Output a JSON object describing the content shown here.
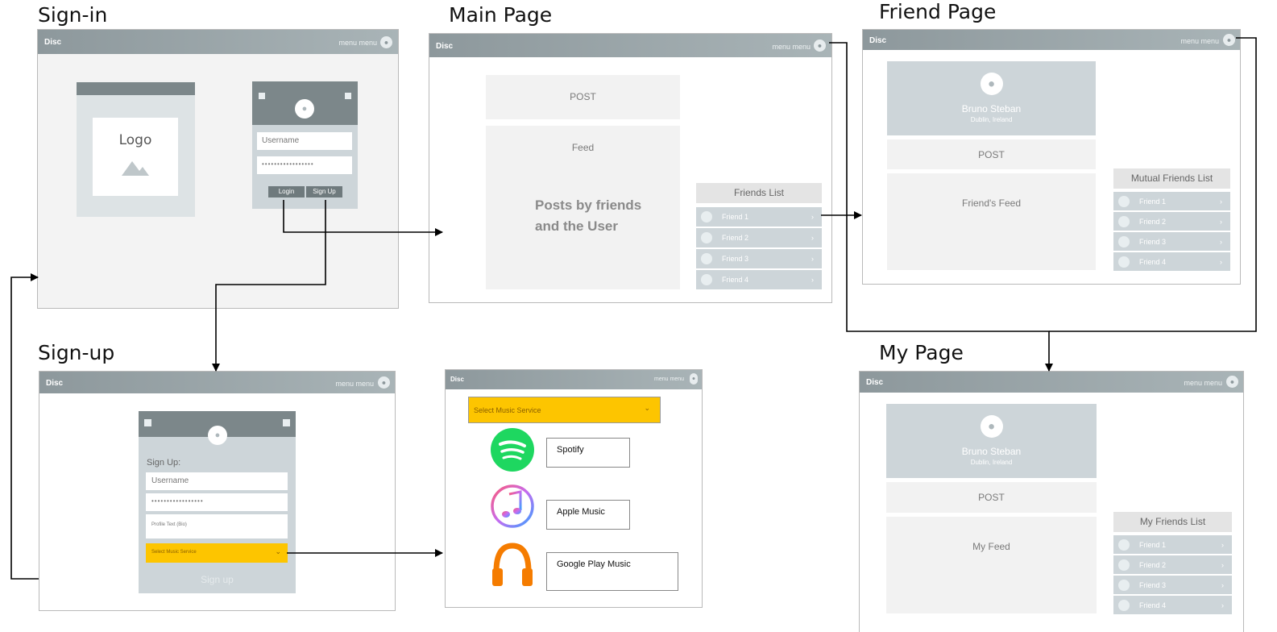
{
  "screens": {
    "signin": "Sign-in",
    "main": "Main Page",
    "friend": "Friend Page",
    "signup": "Sign-up",
    "mypage": "My Page"
  },
  "nav": {
    "brand": "Disc",
    "menu1": "menu",
    "menu2": "menu"
  },
  "signin": {
    "logo": "Logo",
    "username_placeholder": "Username",
    "password_mask": "•••••••••••••••••",
    "login": "Login",
    "signup": "Sign Up"
  },
  "main": {
    "post": "POST",
    "feed": "Feed",
    "feed_note": "Posts by friends and the User",
    "friends_header": "Friends List",
    "friends": [
      "Friend 1",
      "Friend 2",
      "Friend 3",
      "Friend 4"
    ]
  },
  "friend": {
    "name": "Bruno Steban",
    "location": "Dublin, Ireland",
    "post": "POST",
    "feed": "Friend's Feed",
    "list_header": "Mutual Friends List",
    "friends": [
      "Friend 1",
      "Friend 2",
      "Friend 3",
      "Friend 4"
    ]
  },
  "signup": {
    "heading": "Sign Up:",
    "username_placeholder": "Username",
    "password_mask": "•••••••••••••••••",
    "bio_placeholder": "Profile Text (Bio)",
    "music_select": "Select Music Service",
    "submit": "Sign up"
  },
  "music": {
    "select": "Select Music Service",
    "services": [
      "Spotify",
      "Apple Music",
      "Google Play Music"
    ]
  },
  "mypage": {
    "name": "Bruno Steban",
    "location": "Dublin, Ireland",
    "post": "POST",
    "feed": "My Feed",
    "list_header": "My Friends List",
    "friends": [
      "Friend 1",
      "Friend 2",
      "Friend 3",
      "Friend 4"
    ]
  },
  "colors": {
    "accent_yellow": "#fdc500",
    "bar": "#9aa5a9",
    "panel": "#cdd5d9",
    "spotify": "#1ed760",
    "google": "#f57c00"
  },
  "icons": [
    "user-icon",
    "image-icon",
    "chevron-right-icon",
    "chevron-down-icon",
    "spotify-icon",
    "apple-music-icon",
    "google-play-music-icon"
  ]
}
